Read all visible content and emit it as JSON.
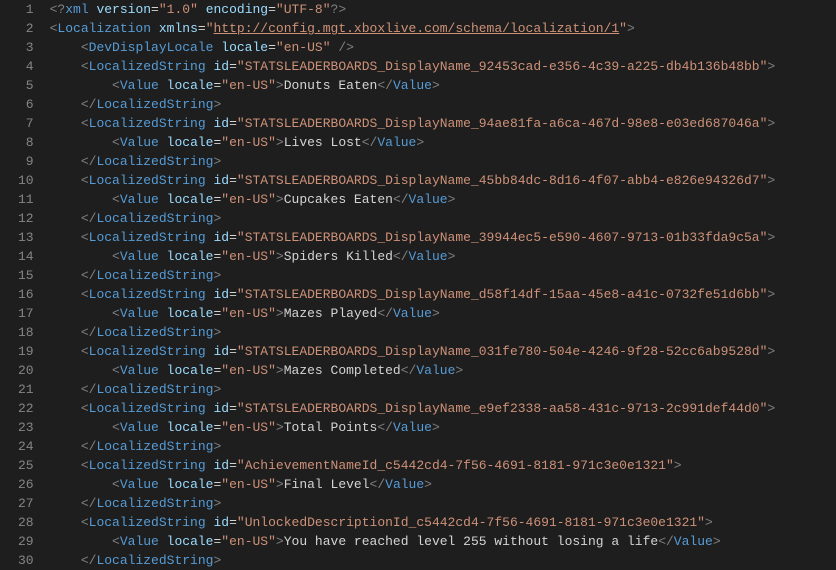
{
  "lineStart": 1,
  "xmlDecl": {
    "version": "1.0",
    "encoding": "UTF-8"
  },
  "root": {
    "name": "Localization",
    "xmlns": "http://config.mgt.xboxlive.com/schema/localization/1"
  },
  "devDisplayLocale": {
    "locale": "en-US"
  },
  "valueLocale": "en-US",
  "items": [
    {
      "id": "STATSLEADERBOARDS_DisplayName_92453cad-e356-4c39-a225-db4b136b48bb",
      "text": "Donuts Eaten"
    },
    {
      "id": "STATSLEADERBOARDS_DisplayName_94ae81fa-a6ca-467d-98e8-e03ed687046a",
      "text": "Lives Lost"
    },
    {
      "id": "STATSLEADERBOARDS_DisplayName_45bb84dc-8d16-4f07-abb4-e826e94326d7",
      "text": "Cupcakes Eaten"
    },
    {
      "id": "STATSLEADERBOARDS_DisplayName_39944ec5-e590-4607-9713-01b33fda9c5a",
      "text": "Spiders Killed"
    },
    {
      "id": "STATSLEADERBOARDS_DisplayName_d58f14df-15aa-45e8-a41c-0732fe51d6bb",
      "text": "Mazes Played"
    },
    {
      "id": "STATSLEADERBOARDS_DisplayName_031fe780-504e-4246-9f28-52cc6ab9528d",
      "text": "Mazes Completed"
    },
    {
      "id": "STATSLEADERBOARDS_DisplayName_e9ef2338-aa58-431c-9713-2c991def44d0",
      "text": "Total Points"
    },
    {
      "id": "AchievementNameId_c5442cd4-7f56-4691-8181-971c3e0e1321",
      "text": "Final Level"
    },
    {
      "id": "UnlockedDescriptionId_c5442cd4-7f56-4691-8181-971c3e0e1321",
      "text": "You have reached level 255 without losing a life"
    }
  ]
}
